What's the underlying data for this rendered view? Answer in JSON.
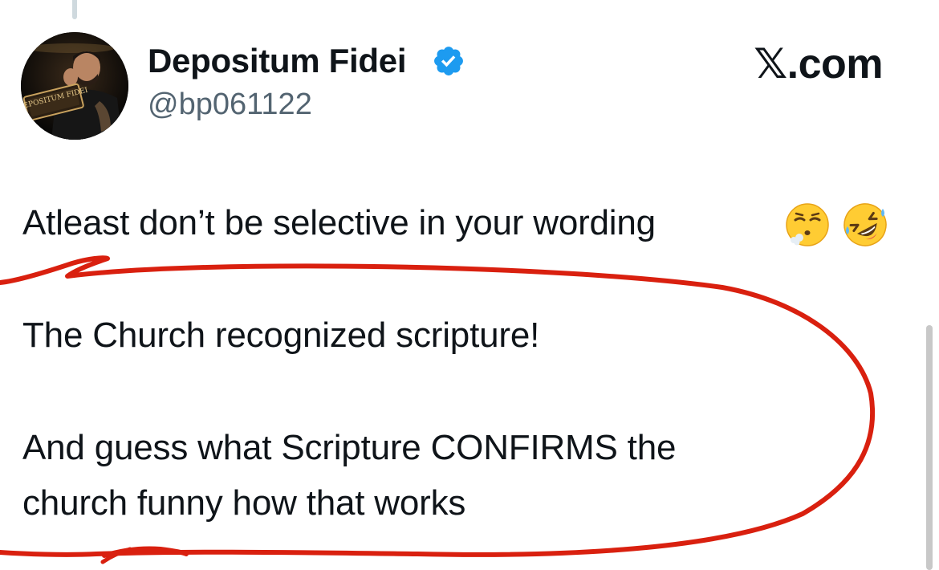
{
  "post": {
    "author": {
      "display_name": "Depositum Fidei",
      "handle": "@bp061122",
      "verified": true,
      "avatar_caption": "DEPOSITUM FIDEI"
    },
    "source_label": "𝕏.com",
    "text_lines": [
      "Atleast don’t be selective in your wording",
      "The Church recognized scripture!",
      "And guess what Scripture CONFIRMS the",
      "church funny how that works"
    ],
    "emojis": [
      "face-exhaling-emoji",
      "rolling-on-floor-laughing-emoji"
    ]
  },
  "annotation": {
    "color": "#d9200f",
    "shape": "freehand-ellipse"
  },
  "colors": {
    "verified": "#1d9bf0",
    "handle": "#536471",
    "text": "#0f1419"
  }
}
